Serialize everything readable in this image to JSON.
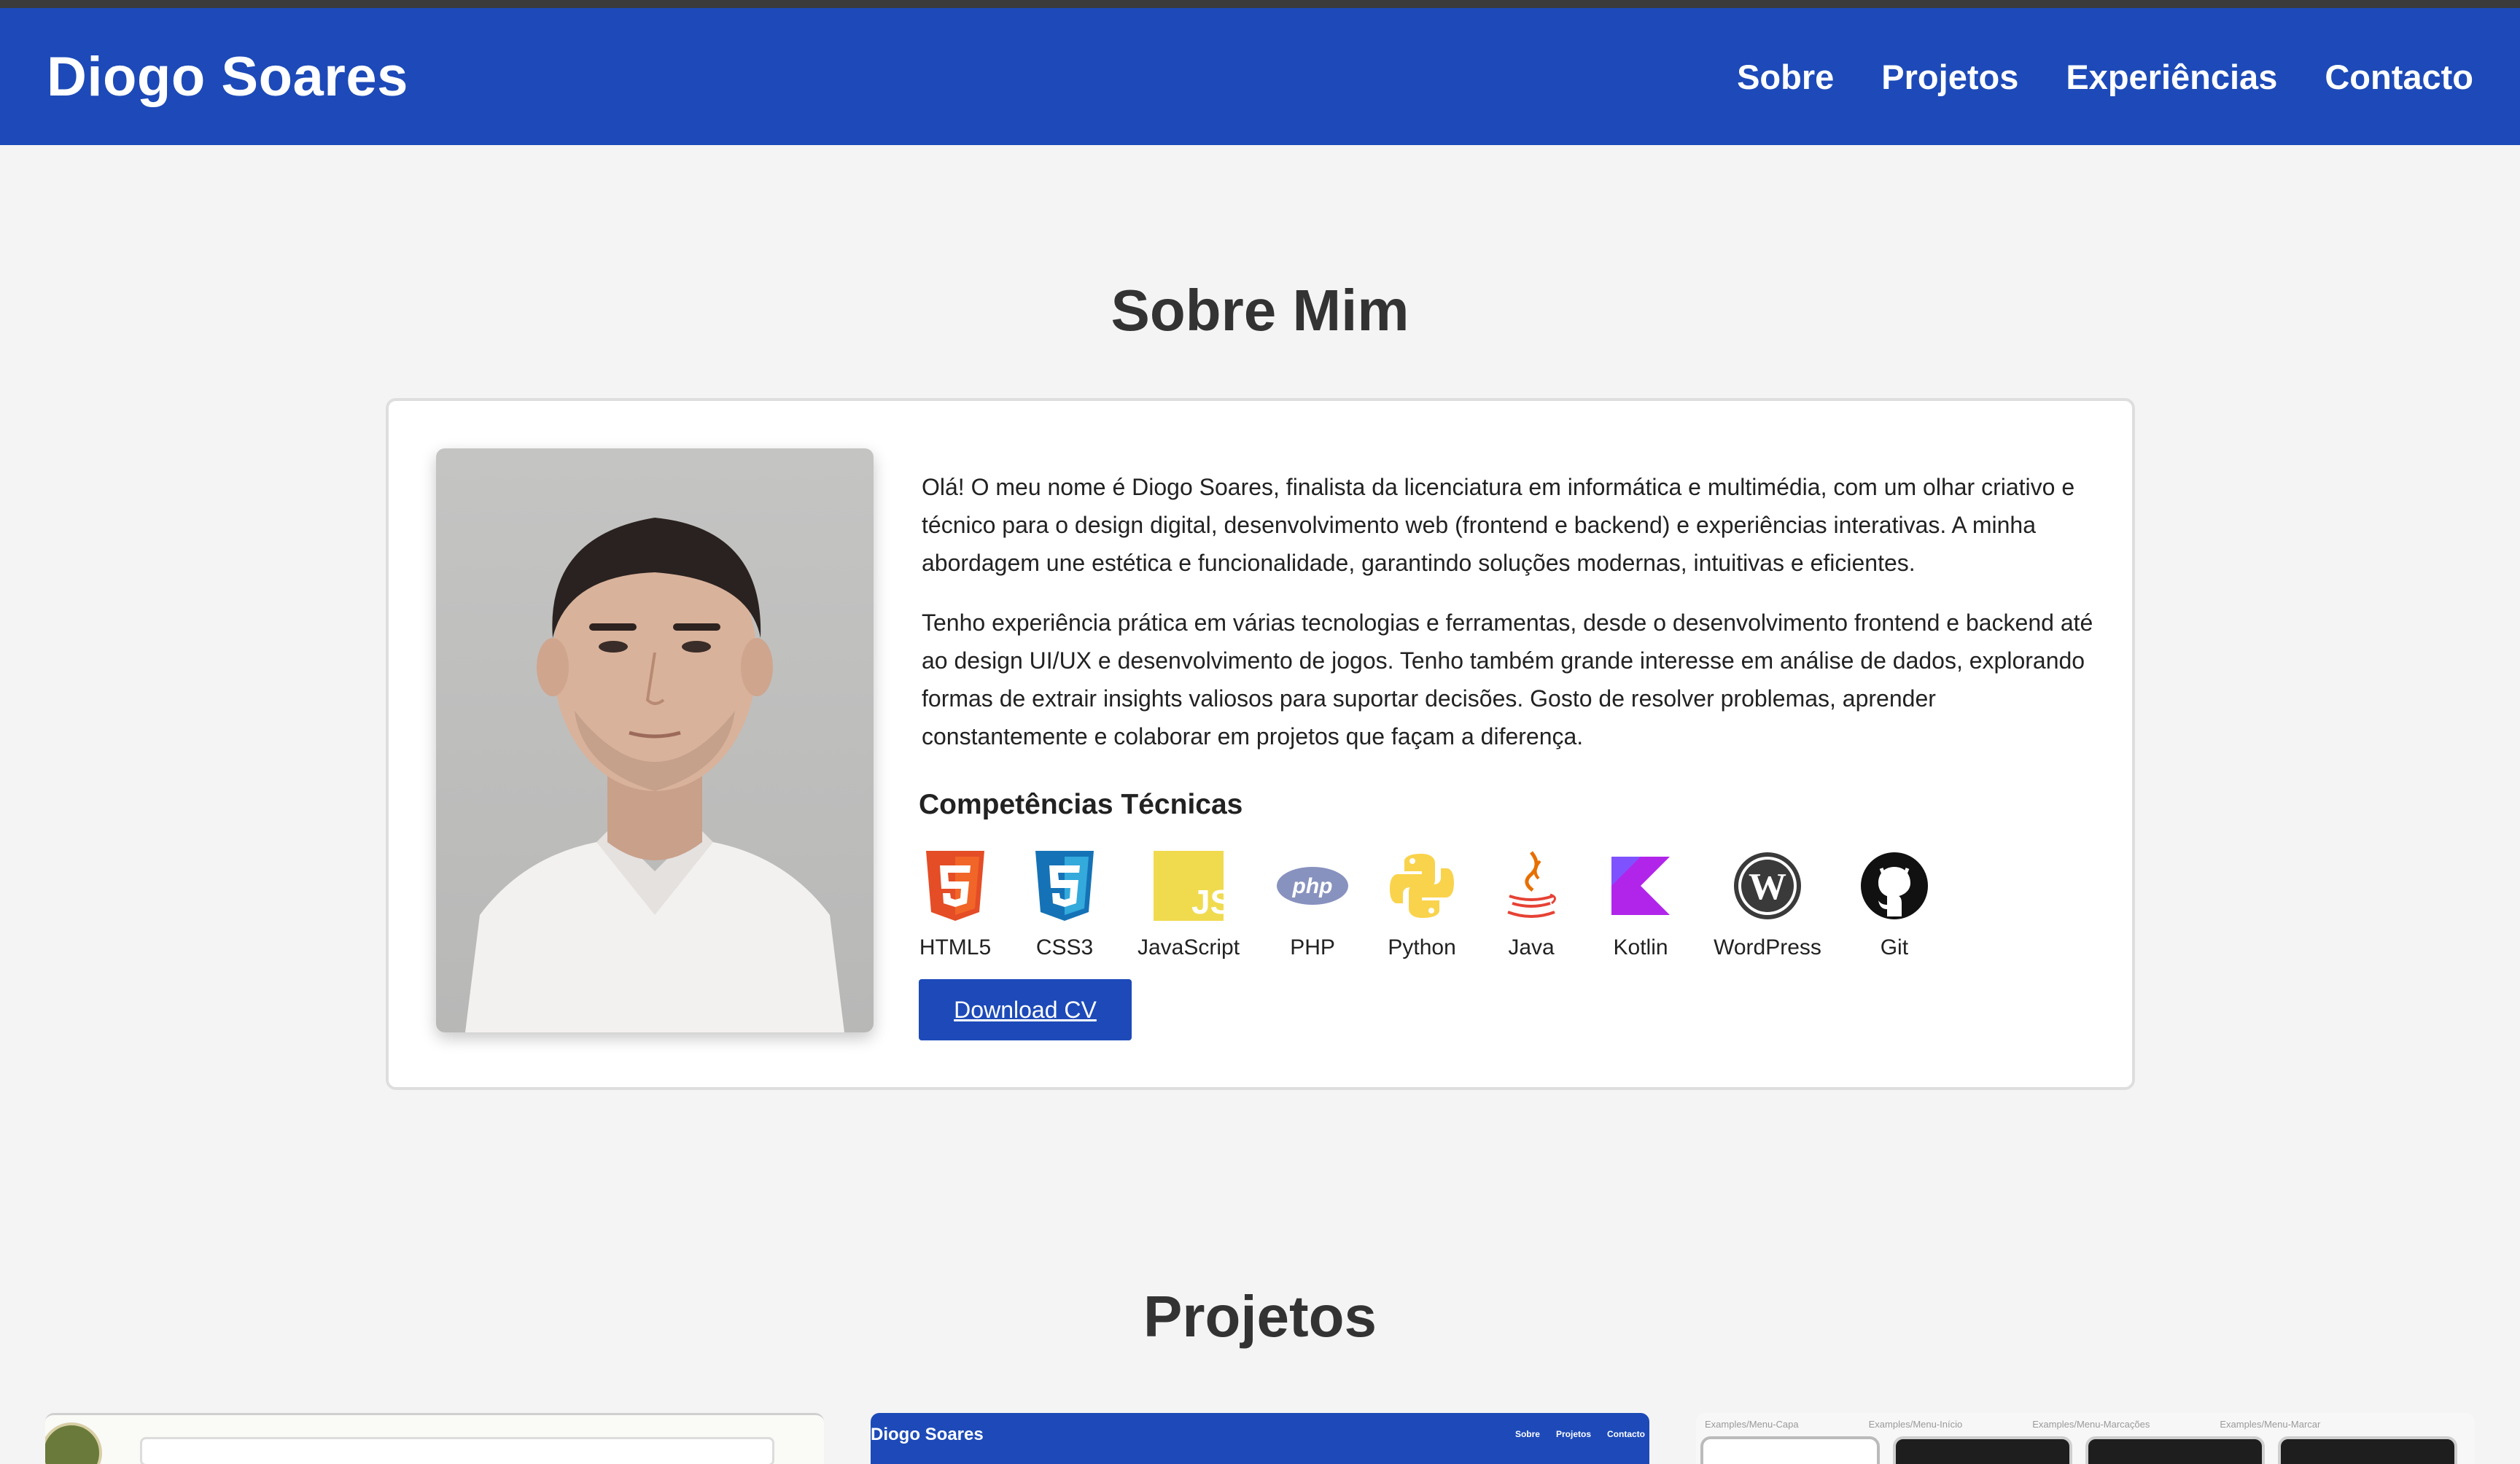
{
  "header": {
    "brand": "Diogo Soares",
    "nav": [
      "Sobre",
      "Projetos",
      "Experiências",
      "Contacto"
    ]
  },
  "about": {
    "title": "Sobre Mim",
    "paragraphs": [
      "Olá! O meu nome é Diogo Soares, finalista da licenciatura em informática e multimédia, com um olhar criativo e técnico para o design digital, desenvolvimento web (frontend e backend) e experiências interativas. A minha abordagem une estética e funcionalidade, garantindo soluções modernas, intuitivas e eficientes.",
      "Tenho experiência prática em várias tecnologias e ferramentas, desde o desenvolvimento frontend e backend até ao design UI/UX e desenvolvimento de jogos. Tenho também grande interesse em análise de dados, explorando formas de extrair insights valiosos para suportar decisões. Gosto de resolver problemas, aprender constantemente e colaborar em projetos que façam a diferença."
    ],
    "skills_title": "Competências Técnicas",
    "skills": [
      {
        "label": "HTML5",
        "icon": "html5-icon"
      },
      {
        "label": "CSS3",
        "icon": "css3-icon"
      },
      {
        "label": "JavaScript",
        "icon": "javascript-icon"
      },
      {
        "label": "PHP",
        "icon": "php-icon"
      },
      {
        "label": "Python",
        "icon": "python-icon"
      },
      {
        "label": "Java",
        "icon": "java-icon"
      },
      {
        "label": "Kotlin",
        "icon": "kotlin-icon"
      },
      {
        "label": "WordPress",
        "icon": "wordpress-icon"
      },
      {
        "label": "Git",
        "icon": "github-icon"
      }
    ],
    "download_label": "Download CV"
  },
  "projects": {
    "title": "Projetos",
    "preview2": {
      "brand": "Diogo Soares",
      "nav": [
        "Sobre",
        "Projetos",
        "Contacto"
      ]
    },
    "preview3_labels": [
      "Examples/Menu-Capa",
      "Examples/Menu-Início",
      "Examples/Menu-Marcações",
      "Examples/Menu-Marcar"
    ]
  },
  "colors": {
    "brand_blue": "#1d4ab8",
    "page_bg": "#f4f4f4"
  }
}
